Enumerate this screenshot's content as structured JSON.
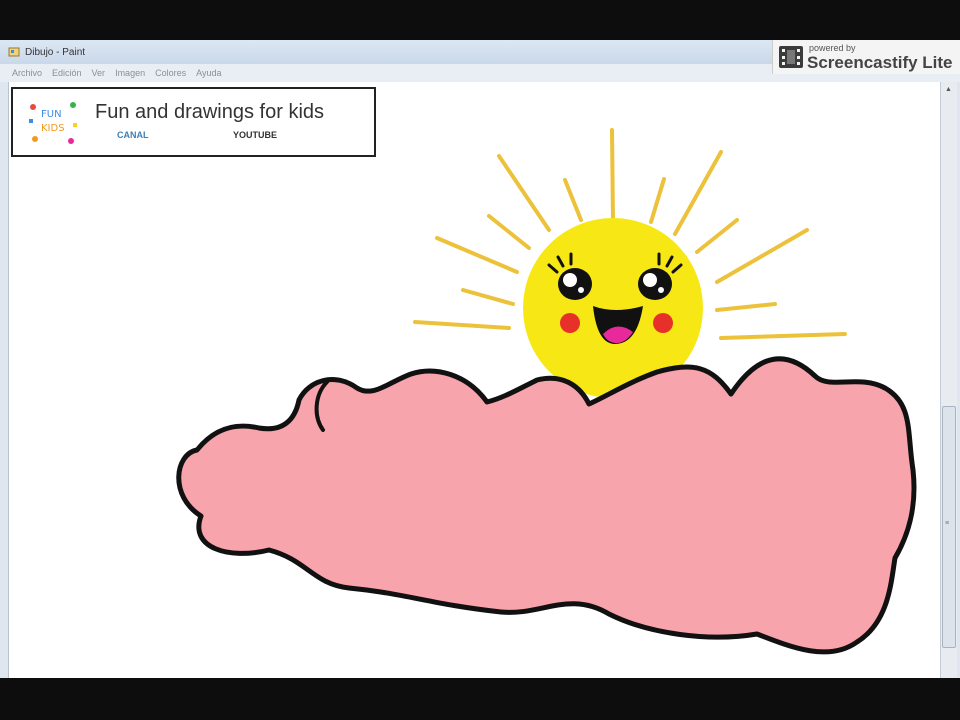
{
  "window": {
    "title": "Dibujo - Paint",
    "menu": [
      "Archivo",
      "Edición",
      "Ver",
      "Imagen",
      "Colores",
      "Ayuda"
    ]
  },
  "watermark": {
    "small_text": "powered by",
    "brand": "Screencastify Lite"
  },
  "channel": {
    "logo_text": "FUN KIDS",
    "title": "Fun and drawings for kids",
    "links": [
      "CANAL",
      "YOUTUBE"
    ]
  },
  "icons": [
    "paint-app-icon",
    "film-icon",
    "scroll-up-icon",
    "scroll-down-icon",
    "scroll-left-icon",
    "scroll-right-icon"
  ],
  "colors": {
    "sun": "#f7e815",
    "rays": "#ecc23a",
    "cloud": "#f8a4ac",
    "outline": "#111111",
    "cheeks": "#e8302a",
    "tongue": "#e9299b",
    "link_blue": "#3d7fb6"
  }
}
